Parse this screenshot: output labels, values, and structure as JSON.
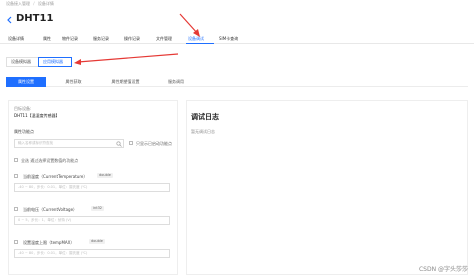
{
  "breadcrumb": [
    "设备接入管理",
    "设备详情"
  ],
  "device": {
    "name": "DHT11"
  },
  "main_tabs": [
    {
      "label": "设备详情"
    },
    {
      "label": "属性"
    },
    {
      "label": "物件记录"
    },
    {
      "label": "服务记录"
    },
    {
      "label": "操作记录"
    },
    {
      "label": "文件管理"
    },
    {
      "label": "设备调试",
      "active": true
    },
    {
      "label": "SIM卡查询"
    }
  ],
  "sub_tabs": [
    {
      "label": "设备模拟器"
    },
    {
      "label": "应用模拟器",
      "active": true
    }
  ],
  "func_tabs": [
    {
      "label": "属性设置",
      "active": true
    },
    {
      "label": "属性获取"
    },
    {
      "label": "属性期望值设置"
    },
    {
      "label": "服务调用"
    }
  ],
  "left": {
    "device_label": "目标设备:",
    "device_value": "DHT11【温湿度传感器】",
    "prop_label": "属性功能点",
    "search_placeholder": "输入名称或标识符查找",
    "only_show_label": "只显示已启动功能点",
    "select_all_label": "全选 通过选择设置数值的功能点",
    "props": [
      {
        "name": "当前温度（CurrentTemperature）",
        "type": "double",
        "hint": "-40 ~ 80，步长：0.01，单位：摄氏度 (℃)"
      },
      {
        "name": "当前电压（CurrentVoltage）",
        "type": "int32",
        "hint": "0 ~ 5，步长：1，单位：伏特 (V)"
      },
      {
        "name": "设置温度上限（tempMAX）",
        "type": "double",
        "hint": "-40 ~ 80，步长：0.01，单位：摄氏度 (℃)"
      }
    ]
  },
  "right": {
    "title": "调试日志",
    "empty_text": "暂无调试日志"
  },
  "watermark": "CSDN @字头莎莎",
  "colors": {
    "accent": "#1f6fff",
    "annotation": "#e53935"
  }
}
